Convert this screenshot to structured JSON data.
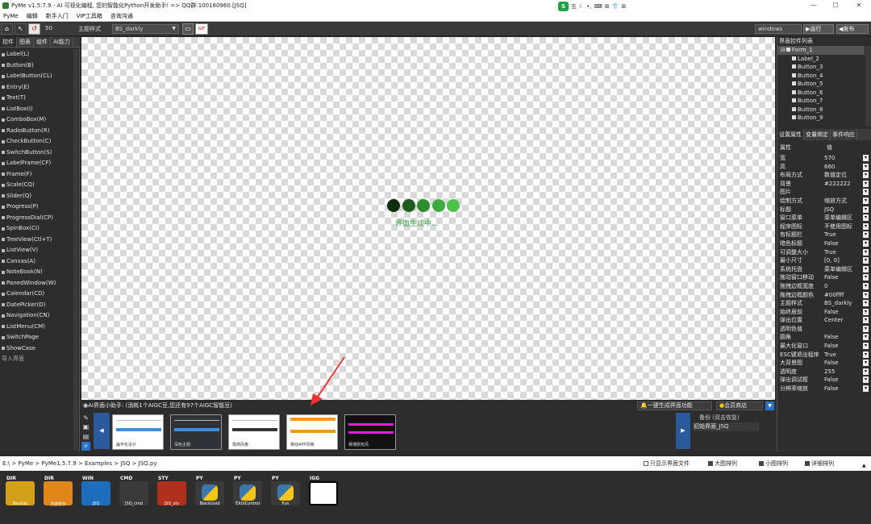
{
  "window": {
    "title": "PyMe v1.5.7.9 - AI 可视化编程, 您的智能化Python开发助手! => QQ群:100180960   [JSQ]",
    "minimize": "—",
    "maximize": "☐",
    "close": "✕"
  },
  "ime": {
    "logo": "S",
    "mode": "五",
    "items": [
      "☾",
      "•,",
      "⌨",
      "⊞",
      "👕",
      "⊞"
    ]
  },
  "menu": [
    "PyMe",
    "编辑",
    "新手入门",
    "VIP工具箱",
    "咨询沟通"
  ],
  "toolbar": {
    "zoom": "50",
    "theme_label": "主题样式",
    "theme_value": "BS_darkly",
    "env_value": "windows",
    "run_label": "▶运行",
    "publish_label": "◀发布"
  },
  "left_tabs": [
    "控件",
    "图表",
    "组件",
    "AI能力"
  ],
  "widgets": [
    "Label(L)",
    "Button(B)",
    "LabelButton(CL)",
    "Entry(E)",
    "Text(T)",
    "ListBox(I)",
    "ComboBox(M)",
    "RadioButton(R)",
    "CheckButton(C)",
    "SwitchButton(S)",
    "LabelFrame(CF)",
    "Frame(F)",
    "Scale(CQ)",
    "Slider(Q)",
    "Progress(P)",
    "ProgressDial(CP)",
    "SpinBox(CI)",
    "TreeView(Ctl+T)",
    "ListView(V)",
    "Canvas(A)",
    "NoteBook(N)",
    "PanedWindow(W)",
    "Calendar(CD)",
    "DatePicker(D)",
    "Navigation(CN)",
    "ListMenu(CM)",
    "SwitchPage",
    "ShowCase",
    "导入界面"
  ],
  "canvas": {
    "loading_text": "界面生成中...",
    "dot_colors": [
      "#0f2e0f",
      "#1f5a1f",
      "#2e8b2e",
      "#3fab3f",
      "#4cc24c"
    ]
  },
  "right_panel": {
    "title": "界面控件列表",
    "tree": [
      "Form_1",
      "Label_2",
      "Button_3",
      "Button_4",
      "Button_5",
      "Button_6",
      "Button_7",
      "Button_8",
      "Button_9"
    ],
    "prop_tabs": [
      "设置属性",
      "变量绑定",
      "事件响应"
    ],
    "prop_header": {
      "key": "属性",
      "value": "值"
    },
    "props": [
      [
        "宽",
        "570"
      ],
      [
        "高",
        "660"
      ],
      [
        "布局方式",
        "数值定位"
      ],
      [
        "背景",
        "#222222"
      ],
      [
        "图片",
        ""
      ],
      [
        "绘制方式",
        "缩放方式"
      ],
      [
        "标题",
        "JSQ"
      ],
      [
        "窗口菜单",
        "菜单编辑区"
      ],
      [
        "程序图标",
        "不使用图标"
      ],
      [
        "有标题栏",
        "True"
      ],
      [
        "暗色标题",
        "False"
      ],
      [
        "可调整大小",
        "True"
      ],
      [
        "最小尺寸",
        "[0, 0]"
      ],
      [
        "系统托盘",
        "菜单编辑区"
      ],
      [
        "拖动窗口移动",
        "False"
      ],
      [
        "拖拽边框宽度",
        "0"
      ],
      [
        "拖拽边框颜色",
        "#00ffff"
      ],
      [
        "主题样式",
        "BS_darkly"
      ],
      [
        "始终居前",
        "False"
      ],
      [
        "弹出位置",
        "Center"
      ],
      [
        "透明色值",
        ""
      ],
      [
        "圆角",
        "False"
      ],
      [
        "最大化窗口",
        "False"
      ],
      [
        "ESC键退出程序",
        "True"
      ],
      [
        "大背景图",
        "False"
      ],
      [
        "透明度",
        "255"
      ],
      [
        "弹出调试框",
        "False"
      ],
      [
        "分辨率缩放",
        "False"
      ]
    ]
  },
  "ai": {
    "label": "AI界面小助手: (消耗1个AIGC豆,您还有97个AIGC智能豆)",
    "generate": "一键生成界面功能",
    "shop": "会员商店",
    "dropdown": "▼"
  },
  "thumbs": [
    {
      "caption": "扁平化设计",
      "kind": "white"
    },
    {
      "caption": "深色主题",
      "kind": "dark"
    },
    {
      "caption": "极简风格",
      "kind": "white"
    },
    {
      "caption": "移动APP风格",
      "kind": "orange"
    },
    {
      "caption": "赛博朋克风",
      "kind": "cyber"
    }
  ],
  "nav": {
    "prev": "◀",
    "next": "▶"
  },
  "backup": {
    "title": "备份 (双击恢复)",
    "item": "初始界面_JSQ"
  },
  "filebar": {
    "path": "E:\\ > PyMe > PyMe1.5.7.9 > Examples > JSQ > JSQ.py",
    "only_ui": "只显示界面文件",
    "big": "大图排列",
    "small": "小图排列",
    "detail": "详细排列",
    "scroll": "▲"
  },
  "files": [
    {
      "type": "DIR",
      "name": "BackUp",
      "color": "#d4a017"
    },
    {
      "type": "DIR",
      "name": "灵感帮手",
      "color": "#e0861a"
    },
    {
      "type": "WIN",
      "name": "JSQ",
      "color": "#1c6fbf"
    },
    {
      "type": "CMD",
      "name": "JSQ_cmd",
      "color": "#3a3a3a"
    },
    {
      "type": "STY",
      "name": "JSQ_sty",
      "color": "#b0301e"
    },
    {
      "type": "PY",
      "name": "BlackGold",
      "color": "#3a3a3a"
    },
    {
      "type": "PY",
      "name": "EXUIControl",
      "color": "#3a3a3a"
    },
    {
      "type": "PY",
      "name": "Fun",
      "color": "#3a3a3a"
    },
    {
      "type": "IGG",
      "name": "",
      "color": "#222222"
    }
  ]
}
